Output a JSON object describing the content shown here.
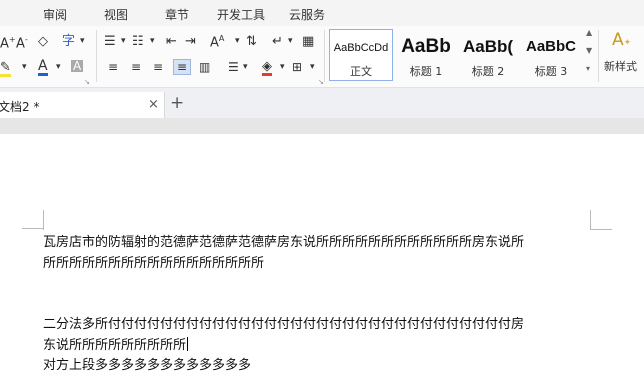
{
  "menubar": {
    "items": [
      "审阅",
      "视图",
      "章节",
      "开发工具",
      "云服务"
    ]
  },
  "ribbon": {
    "styles": [
      {
        "preview": "AaBbCcDd",
        "label": "正文"
      },
      {
        "preview": "AaBb",
        "label": "标题 1"
      },
      {
        "preview": "AaBb(",
        "label": "标题 2"
      },
      {
        "preview": "AaBbC",
        "label": "标题 3"
      }
    ],
    "new_style_label": "新样式"
  },
  "tabs": {
    "doc_title": "文档2 *",
    "close_glyph": "×",
    "new_tab_glyph": "+"
  },
  "document": {
    "paragraphs": [
      "瓦房店市的防辐射的范德萨范德萨范德萨房东说所所所所所所所所所所所所房东说所",
      "所所所所所所所所所所所所所所所所所",
      "二分法多所付付付付付付付付付付付付付付付付付付付付付付付付付付付付付付付房",
      "东说所所所所所所所所所",
      " 对方上段多多多多多多多多多多多多"
    ]
  },
  "colors": {
    "menubar_bg": "#f4f4f4",
    "ribbon_bg": "#fbfbfb",
    "tabstrip_bg": "#eef0f3",
    "active_style_border": "#8fb0e8",
    "highlight_yellow": "#f7e23a",
    "font_color_blue": "#1f5fd1",
    "fill_color_red": "#e33b2e"
  }
}
